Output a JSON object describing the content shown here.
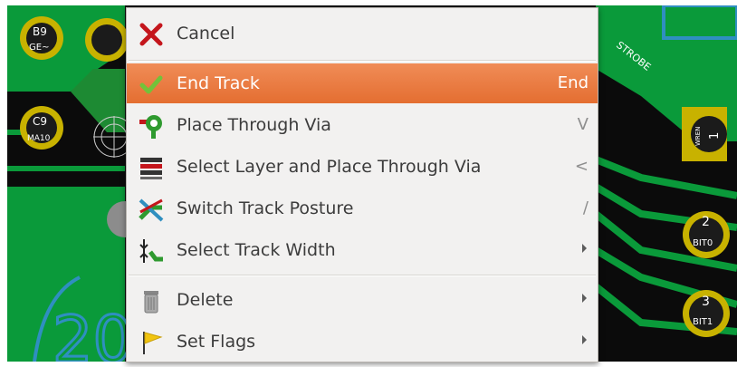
{
  "board": {
    "pads": [
      {
        "number": "B9",
        "net": "GE~"
      },
      {
        "number": "C9",
        "net": "MA10"
      },
      {
        "number": "2",
        "net": "BIT0"
      },
      {
        "number": "3",
        "net": "BIT1"
      },
      {
        "number": "1",
        "net": "WREN"
      }
    ],
    "net_label": "STROBE",
    "silk_text": "20"
  },
  "context_menu": {
    "items": [
      {
        "label": "Cancel",
        "shortcut": "",
        "icon": "cancel-x-icon"
      },
      {
        "label": "End Track",
        "shortcut": "End",
        "icon": "checkmark-icon",
        "highlighted": true
      },
      {
        "label": "Place Through Via",
        "shortcut": "V",
        "icon": "via-icon"
      },
      {
        "label": "Select Layer and Place Through Via",
        "shortcut": "<",
        "icon": "layers-icon"
      },
      {
        "label": "Switch Track Posture",
        "shortcut": "/",
        "icon": "track-posture-icon"
      },
      {
        "label": "Select Track Width",
        "shortcut": "",
        "icon": "track-width-icon",
        "submenu": true
      },
      {
        "label": "Delete",
        "shortcut": "",
        "icon": "trash-icon",
        "submenu": true
      },
      {
        "label": "Set Flags",
        "shortcut": "",
        "icon": "flag-icon",
        "submenu": true
      }
    ]
  },
  "colors": {
    "copper_green": "#0a9a3a",
    "pad_gold": "#c8b200",
    "highlight": "#e97a3e",
    "silk_blue": "#2f8fc0"
  }
}
